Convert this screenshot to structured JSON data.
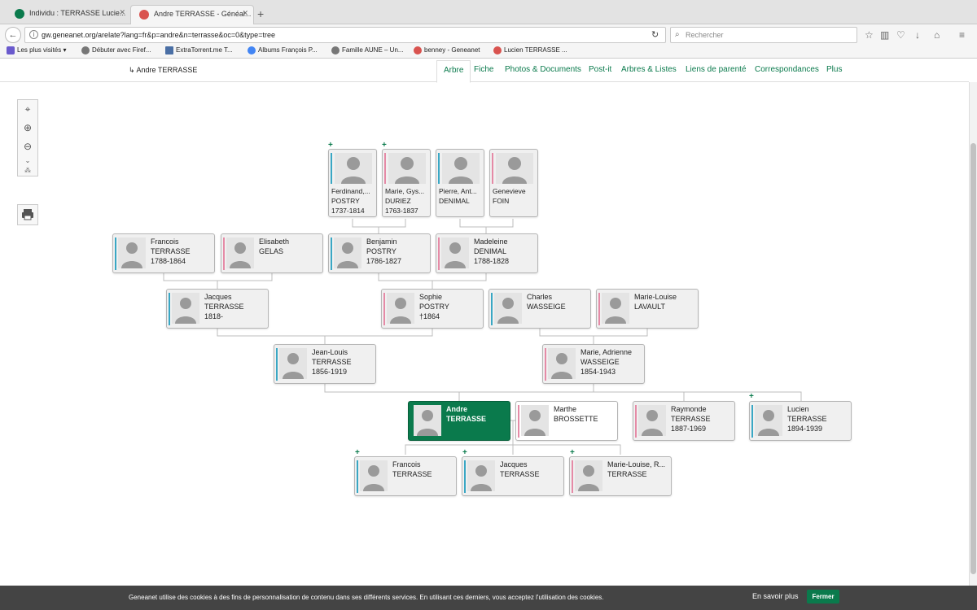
{
  "browser": {
    "tabs": [
      {
        "label": "Individu : TERRASSE Lucie...",
        "active": false
      },
      {
        "label": "Andre TERRASSE - Généal...",
        "active": true
      }
    ],
    "url": "gw.geneanet.org/arelate?lang=fr&p=andre&n=terrasse&oc=0&type=tree",
    "search_placeholder": "Rechercher",
    "bookmarks": [
      "Les plus visités ▾",
      "Débuter avec Firef...",
      "ExtraTorrent.me T...",
      "Albums François P...",
      "Famille AUNE – Un...",
      "benney - Geneanet",
      "Lucien TERRASSE ..."
    ]
  },
  "header": {
    "breadcrumb": "↳ Andre TERRASSE",
    "nav": [
      "Arbre",
      "Fiche",
      "Photos & Documents",
      "Post-it",
      "Arbres & Listes",
      "Liens de parenté",
      "Correspondances",
      "Plus"
    ],
    "active_nav": "Arbre"
  },
  "tree": {
    "great_grandparents": [
      {
        "first": "Ferdinand,...",
        "last": "POSTRY",
        "dates": "1737-1814",
        "gender": "m",
        "has_more": true
      },
      {
        "first": "Marie, Gys...",
        "last": "DURIEZ",
        "dates": "1763-1837",
        "gender": "f",
        "has_more": true
      },
      {
        "first": "Pierre, Ant...",
        "last": "DENIMAL",
        "dates": "",
        "gender": "m",
        "has_more": false
      },
      {
        "first": "Genevieve",
        "last": "FOIN",
        "dates": "",
        "gender": "f",
        "has_more": false
      }
    ],
    "gen3": [
      {
        "first": "Francois",
        "last": "TERRASSE",
        "dates": "1788-1864",
        "gender": "m"
      },
      {
        "first": "Elisabeth",
        "last": "GELAS",
        "dates": "",
        "gender": "f"
      },
      {
        "first": "Benjamin",
        "last": "POSTRY",
        "dates": "1786-1827",
        "gender": "m"
      },
      {
        "first": "Madeleine",
        "last": "DENIMAL",
        "dates": "1788-1828",
        "gender": "f"
      }
    ],
    "gen2": [
      {
        "first": "Jacques",
        "last": "TERRASSE",
        "dates": "1818-",
        "gender": "m"
      },
      {
        "first": "Sophie",
        "last": "POSTRY",
        "dates": "†1864",
        "gender": "f"
      },
      {
        "first": "Charles",
        "last": "WASSEIGE",
        "dates": "",
        "gender": "m"
      },
      {
        "first": "Marie-Louise",
        "last": "LAVAULT",
        "dates": "",
        "gender": "f"
      }
    ],
    "parents": [
      {
        "first": "Jean-Louis",
        "last": "TERRASSE",
        "dates": "1856-1919",
        "gender": "m"
      },
      {
        "first": "Marie, Adrienne",
        "last": "WASSEIGE",
        "dates": "1854-1943",
        "gender": "f"
      }
    ],
    "root": {
      "first": "Andre",
      "last": "TERRASSE",
      "dates": ""
    },
    "spouse": {
      "first": "Marthe",
      "last": "BROSSETTE",
      "dates": "",
      "gender": "f"
    },
    "siblings": [
      {
        "first": "Raymonde",
        "last": "TERRASSE",
        "dates": "1887-1969",
        "gender": "f",
        "has_more": false
      },
      {
        "first": "Lucien",
        "last": "TERRASSE",
        "dates": "1894-1939",
        "gender": "m",
        "has_more": true
      }
    ],
    "children": [
      {
        "first": "Francois",
        "last": "TERRASSE",
        "dates": "",
        "gender": "m",
        "has_more": true
      },
      {
        "first": "Jacques",
        "last": "TERRASSE",
        "dates": "",
        "gender": "m",
        "has_more": true
      },
      {
        "first": "Marie-Louise, R...",
        "last": "TERRASSE",
        "dates": "",
        "gender": "f",
        "has_more": true
      }
    ]
  },
  "cookie": {
    "message": "Geneanet utilise des cookies à des fins de personnalisation de contenu dans ses différents services. En utilisant ces derniers, vous acceptez l'utilisation des cookies.",
    "learn_more": "En savoir plus",
    "close": "Fermer"
  },
  "colors": {
    "male": "#39a7c4",
    "female": "#e58aa6",
    "accent": "#0a7a4c"
  }
}
